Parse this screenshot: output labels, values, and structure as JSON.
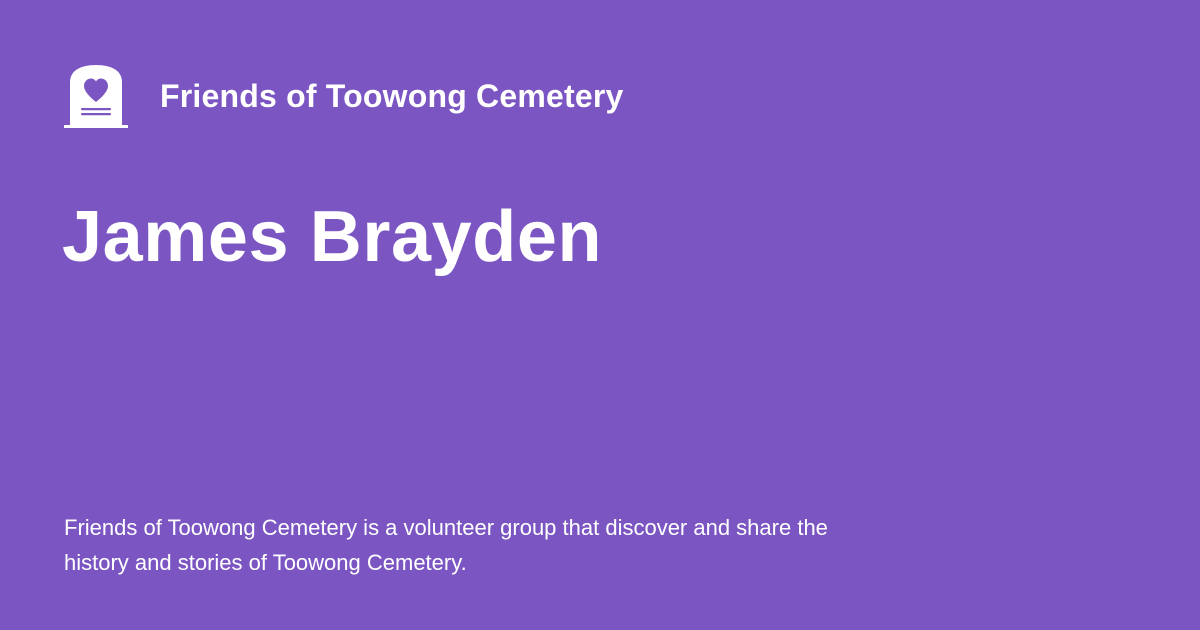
{
  "brand": {
    "logo_icon": "gravestone-heart-icon",
    "name": "Friends of Toowong Cemetery"
  },
  "title": "James Brayden",
  "description": "Friends of Toowong Cemetery is a volunteer group that discover and share the history and stories of Toowong Cemetery.",
  "colors": {
    "background": "#7b56c2",
    "text": "#ffffff"
  }
}
